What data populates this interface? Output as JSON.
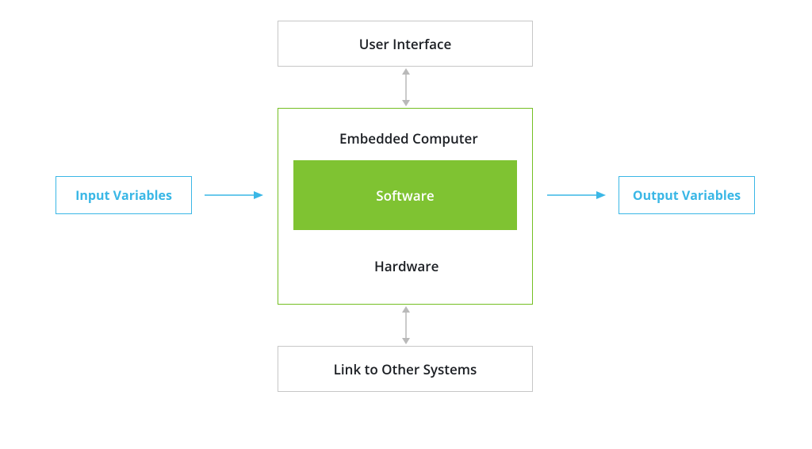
{
  "boxes": {
    "user_interface": "User Interface",
    "embedded_computer": "Embedded Computer",
    "software": "Software",
    "hardware": "Hardware",
    "link_other_systems": "Link to Other Systems",
    "input_variables": "Input Variables",
    "output_variables": "Output Variables"
  },
  "colors": {
    "gray_border": "#c7c7c7",
    "blue": "#3ab7e6",
    "green_border": "#74bf22",
    "green_fill": "#7fc332",
    "text_dark": "#1c1f24",
    "arrow_gray": "#b9b9b9",
    "arrow_blue": "#3ab7e6"
  }
}
